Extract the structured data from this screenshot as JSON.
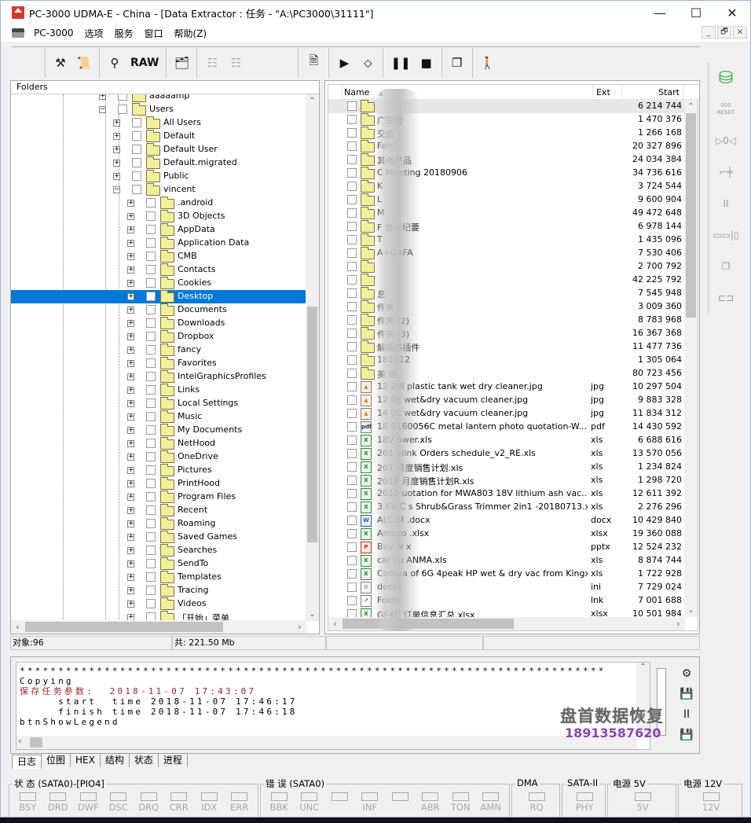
{
  "window": {
    "title": "PC-3000 UDMA-E - China - [Data Extractor : 任务 - \"A:\\PC3000\\31111\"]",
    "controls": {
      "minimize": "—",
      "maximize": "☐",
      "close": "✕"
    },
    "mdi_controls": {
      "minimize": "_",
      "restore": "🗗",
      "close": "✕"
    }
  },
  "menu": {
    "items": [
      "PC-3000",
      "选项",
      "服务",
      "窗口",
      "帮助(Z)"
    ]
  },
  "toolbar": {
    "buttons": [
      {
        "name": "tools-icon",
        "glyph": "⚒"
      },
      {
        "name": "info-scroll-icon",
        "glyph": "📜"
      },
      {
        "name": "binoculars-icon",
        "glyph": "⚲"
      },
      {
        "name": "raw-button",
        "glyph": "RAW"
      },
      {
        "name": "folder-arrow-icon",
        "glyph": "🗂"
      },
      {
        "name": "tree-gray-icon",
        "glyph": "☷"
      },
      {
        "name": "tree-filled-gray-icon",
        "glyph": "☷"
      },
      {
        "name": "document-check-icon",
        "glyph": "🗎"
      },
      {
        "name": "play-icon",
        "glyph": "▶"
      },
      {
        "name": "flowchart-decision-icon",
        "glyph": "⬦"
      },
      {
        "name": "pause-icon",
        "glyph": "❚❚"
      },
      {
        "name": "stop-icon",
        "glyph": "■"
      },
      {
        "name": "windows-stack-icon",
        "glyph": "❐"
      },
      {
        "name": "exit-runner-icon",
        "glyph": "🚶"
      }
    ]
  },
  "right_tools": [
    {
      "name": "copy-drive-icon",
      "glyph": "⛁"
    },
    {
      "name": "reset-counter-icon",
      "glyph": "000",
      "sub": "RESET"
    },
    {
      "name": "drive-head-icon",
      "glyph": "▷0◁"
    },
    {
      "name": "switch-circuit-icon",
      "glyph": "⌐╪"
    },
    {
      "name": "pause-small-icon",
      "glyph": "II"
    },
    {
      "name": "block-transfer-icon",
      "glyph": "▭▭|▯"
    },
    {
      "name": "copy-windows-x-icon",
      "glyph": "❐"
    },
    {
      "name": "connector-icon",
      "glyph": "⊏⊐"
    }
  ],
  "folders": {
    "header": "Folders",
    "items": [
      {
        "label": "aaaaamp",
        "level": 0,
        "expanded": false,
        "partial": true
      },
      {
        "label": "Users",
        "level": 0,
        "expanded": true
      },
      {
        "label": "All Users",
        "level": 1,
        "expanded": false
      },
      {
        "label": "Default",
        "level": 1,
        "expanded": false
      },
      {
        "label": "Default User",
        "level": 1,
        "expanded": false
      },
      {
        "label": "Default.migrated",
        "level": 1,
        "expanded": false
      },
      {
        "label": "Public",
        "level": 1,
        "expanded": false
      },
      {
        "label": "vincent",
        "level": 1,
        "expanded": true
      },
      {
        "label": ".android",
        "level": 2,
        "expanded": false
      },
      {
        "label": "3D Objects",
        "level": 2,
        "expanded": false
      },
      {
        "label": "AppData",
        "level": 2,
        "expanded": false
      },
      {
        "label": "Application Data",
        "level": 2,
        "expanded": false
      },
      {
        "label": "CMB",
        "level": 2,
        "expanded": false
      },
      {
        "label": "Contacts",
        "level": 2,
        "expanded": false
      },
      {
        "label": "Cookies",
        "level": 2,
        "expanded": false
      },
      {
        "label": "Desktop",
        "level": 2,
        "expanded": false,
        "selected": true
      },
      {
        "label": "Documents",
        "level": 2,
        "expanded": false
      },
      {
        "label": "Downloads",
        "level": 2,
        "expanded": false
      },
      {
        "label": "Dropbox",
        "level": 2,
        "expanded": false
      },
      {
        "label": "fancy",
        "level": 2,
        "expanded": false
      },
      {
        "label": "Favorites",
        "level": 2,
        "expanded": false
      },
      {
        "label": "IntelGraphicsProfiles",
        "level": 2,
        "expanded": false
      },
      {
        "label": "Links",
        "level": 2,
        "expanded": false
      },
      {
        "label": "Local Settings",
        "level": 2,
        "expanded": false
      },
      {
        "label": "Music",
        "level": 2,
        "expanded": false
      },
      {
        "label": "My Documents",
        "level": 2,
        "expanded": false
      },
      {
        "label": "NetHood",
        "level": 2,
        "expanded": false
      },
      {
        "label": "OneDrive",
        "level": 2,
        "expanded": false
      },
      {
        "label": "Pictures",
        "level": 2,
        "expanded": false
      },
      {
        "label": "PrintHood",
        "level": 2,
        "expanded": false
      },
      {
        "label": "Program Files",
        "level": 2,
        "expanded": false
      },
      {
        "label": "Recent",
        "level": 2,
        "expanded": false
      },
      {
        "label": "Roaming",
        "level": 2,
        "expanded": false
      },
      {
        "label": "Saved Games",
        "level": 2,
        "expanded": false
      },
      {
        "label": "Searches",
        "level": 2,
        "expanded": false
      },
      {
        "label": "SendTo",
        "level": 2,
        "expanded": false
      },
      {
        "label": "Templates",
        "level": 2,
        "expanded": false
      },
      {
        "label": "Tracing",
        "level": 2,
        "expanded": false
      },
      {
        "label": "Videos",
        "level": 2,
        "expanded": false
      },
      {
        "label": "「开始」菜单",
        "level": 2,
        "expanded": false
      }
    ]
  },
  "files": {
    "columns": {
      "name": "Name",
      "sort_indicator": "▲",
      "ext": "Ext",
      "start": "Start"
    },
    "rows": [
      {
        "name": "",
        "ext": "",
        "start": "6 214 744",
        "type": "folder",
        "highlighted": true
      },
      {
        "name": "广交会",
        "ext": "",
        "start": "1 470 376",
        "type": "folder"
      },
      {
        "name": "交会",
        "ext": "",
        "start": "1 266 168",
        "type": "folder"
      },
      {
        "name": "Fair",
        "ext": "",
        "start": "20 327 896",
        "type": "folder"
      },
      {
        "name": "其他产品",
        "ext": "",
        "start": "24 034 384",
        "type": "folder"
      },
      {
        "name": "C Meeting 20180906",
        "ext": "",
        "start": "34 736 616",
        "type": "folder"
      },
      {
        "name": "K",
        "ext": "",
        "start": "3 724 544",
        "type": "folder"
      },
      {
        "name": "L",
        "ext": "",
        "start": "9 600 904",
        "type": "folder"
      },
      {
        "name": "M",
        "ext": "",
        "start": "49 472 648",
        "type": "folder"
      },
      {
        "name": "F 会议纪要",
        "ext": "",
        "start": "6 978 144",
        "type": "folder"
      },
      {
        "name": "T",
        "ext": "",
        "start": "1 435 096",
        "type": "folder"
      },
      {
        "name": "A+GAFA",
        "ext": "",
        "start": "7 530 406",
        "type": "folder"
      },
      {
        "name": "",
        "ext": "",
        "start": "2 700 792",
        "type": "folder"
      },
      {
        "name": "",
        "ext": "",
        "start": "42 225 792",
        "type": "folder"
      },
      {
        "name": "息",
        "ext": "",
        "start": "7 545 948",
        "type": "folder"
      },
      {
        "name": "件夹",
        "ext": "",
        "start": "3 009 360",
        "type": "folder"
      },
      {
        "name": "件夹 (2)",
        "ext": "",
        "start": "8 783 968",
        "type": "folder"
      },
      {
        "name": "件夹 (3)",
        "ext": "",
        "start": "16 367 368",
        "type": "folder"
      },
      {
        "name": "解版JS插件",
        "ext": "",
        "start": "11 477 736",
        "type": "folder"
      },
      {
        "name": "181012",
        "ext": "",
        "start": "1 305 064",
        "type": "folder"
      },
      {
        "name": "美 场",
        "ext": "",
        "start": "80 723 456",
        "type": "folder"
      },
      {
        "name": "12 20l plastic tank wet dry cleaner.jpg",
        "ext": "jpg",
        "start": "10 297 504",
        "type": "jpg"
      },
      {
        "name": "12 0L wet&dry vacuum cleaner.jpg",
        "ext": "jpg",
        "start": "9 883 328",
        "type": "jpg"
      },
      {
        "name": "14 0L wet&dry vacuum cleaner.jpg",
        "ext": "jpg",
        "start": "11 834 312",
        "type": "jpg"
      },
      {
        "name": "18 S160056C metal lantern photo quotation-W...",
        "ext": "pdf",
        "start": "14 430 592",
        "type": "pdf"
      },
      {
        "name": "18V ower.xls",
        "ext": "xls",
        "start": "6 688 616",
        "type": "xls"
      },
      {
        "name": "201 elink Orders schedule_v2_RE.xls",
        "ext": "xls",
        "start": "13 570 056",
        "type": "xls"
      },
      {
        "name": "201 月度销售计划.xls",
        "ext": "xls",
        "start": "1 234 824",
        "type": "xls"
      },
      {
        "name": "2018 月度销售计划R.xls",
        "ext": "xls",
        "start": "1 298 720",
        "type": "xls"
      },
      {
        "name": "2018 uotation for MWA803 18V lithium ash vac...",
        "ext": "xls",
        "start": "12 611 392",
        "type": "xls"
      },
      {
        "name": "3.6V C s Shrub&Grass Trimmer 2in1 -20180713.xls",
        "ext": "xls",
        "start": "2 276 296",
        "type": "xls"
      },
      {
        "name": "ALC M .docx",
        "ext": "docx",
        "start": "10 429 840",
        "type": "docx"
      },
      {
        "name": "Amazo .xlsx",
        "ext": "xlsx",
        "start": "19 360 088",
        "type": "xls"
      },
      {
        "name": "Buy w x",
        "ext": "pptx",
        "start": "12 524 232",
        "type": "pptx"
      },
      {
        "name": "car cu ANMA.xls",
        "ext": "xls",
        "start": "8 874 744",
        "type": "xls"
      },
      {
        "name": "Compa of 6G 4peak HP wet & dry vac from Kingx...",
        "ext": "xls",
        "start": "1 722 928",
        "type": "xls"
      },
      {
        "name": "deskt",
        "ext": "ini",
        "start": "7 729 024",
        "type": "ini"
      },
      {
        "name": "Foxm",
        "ext": "lnk",
        "start": "7 001 688",
        "type": "lnk"
      },
      {
        "name": "GEKC 订单信息汇总.xlsx",
        "ext": "xlsx",
        "start": "10 501 984",
        "type": "xls"
      }
    ]
  },
  "status": {
    "objects": "对象:96",
    "total": "共: 221.50 Mb",
    "empty1": "",
    "empty2": ""
  },
  "log": {
    "lines": [
      {
        "text": "****************************************************************************",
        "color": "normal"
      },
      {
        "text": "Copying",
        "color": "normal"
      },
      {
        "text": "保存任务参数:  2018-11-07 17:43:07",
        "color": "red"
      },
      {
        "text": "     start  time 2018-11-07 17:46:17",
        "color": "normal"
      },
      {
        "text": "     finish time 2018-11-07 17:46:18",
        "color": "normal"
      },
      {
        "text": "btnShowLegend",
        "color": "normal"
      }
    ],
    "side_buttons": [
      {
        "name": "log-settings-icon",
        "glyph": "⚙"
      },
      {
        "name": "save-icon",
        "glyph": "💾"
      },
      {
        "name": "pause-log-icon",
        "glyph": "II"
      },
      {
        "name": "save-as-icon",
        "glyph": "💾"
      }
    ]
  },
  "watermark": {
    "text": "盘首数据恢复",
    "phone": "18913587620"
  },
  "tabs": [
    "日志",
    "位图",
    "HEX",
    "结构",
    "状态",
    "进程"
  ],
  "indicators": {
    "groups": [
      {
        "title": "状 态 (SATA0)-[PIO4]",
        "leds": [
          "BSY",
          "DRD",
          "DWF",
          "DSC",
          "DRQ",
          "CRR",
          "IDX",
          "ERR"
        ]
      },
      {
        "title": "错 误 (SATA0)",
        "leds": [
          "BBK",
          "UNC",
          "",
          "INF",
          "",
          "ABR",
          "TON",
          "AMN"
        ]
      },
      {
        "title": "DMA",
        "leds": [
          "RQ"
        ]
      },
      {
        "title": "SATA-II",
        "leds": [
          "PHY"
        ]
      },
      {
        "title": "电源 5V",
        "leds": [
          "5V"
        ]
      },
      {
        "title": "电源 12V",
        "leds": [
          "12V"
        ]
      }
    ]
  },
  "colors": {
    "selection": "#0078d7",
    "log_red": "#a0262b",
    "watermark_phone": "#8a44b8"
  }
}
